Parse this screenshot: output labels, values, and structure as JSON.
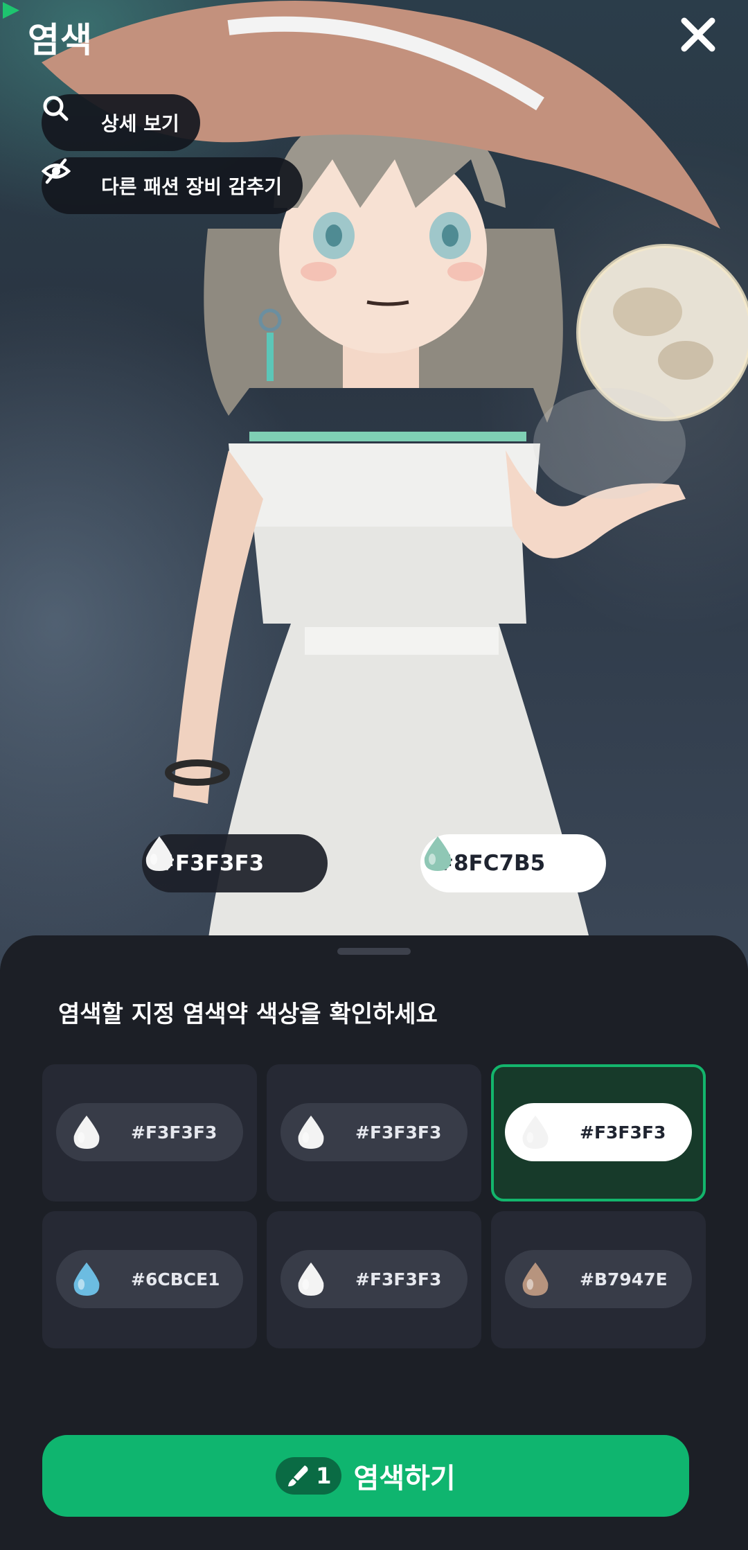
{
  "header": {
    "title": "염색"
  },
  "buttons": {
    "detail_view": "상세 보기",
    "hide_other_fashion": "다른 패션 장비 감추기"
  },
  "color_change": {
    "from": {
      "hex": "#F3F3F3",
      "color": "#F3F3F3"
    },
    "to": {
      "hex": "#8FC7B5",
      "color": "#8FC7B5"
    },
    "arrow_color": "#1ec46f"
  },
  "sheet": {
    "title": "염색할 지정 염색약 색상을 확인하세요",
    "swatches": [
      {
        "hex": "#F3F3F3",
        "color": "#F3F3F3",
        "selected": false
      },
      {
        "hex": "#F3F3F3",
        "color": "#F3F3F3",
        "selected": false
      },
      {
        "hex": "#F3F3F3",
        "color": "#F3F3F3",
        "selected": true
      },
      {
        "hex": "#6CBCE1",
        "color": "#6CBCE1",
        "selected": false
      },
      {
        "hex": "#F3F3F3",
        "color": "#F3F3F3",
        "selected": false
      },
      {
        "hex": "#B7947E",
        "color": "#B7947E",
        "selected": false
      }
    ]
  },
  "cta": {
    "count": "1",
    "label": "염색하기",
    "icon": "dye-brush-icon"
  },
  "colors": {
    "accent": "#0fb56f",
    "selected_border": "#13b56c"
  }
}
